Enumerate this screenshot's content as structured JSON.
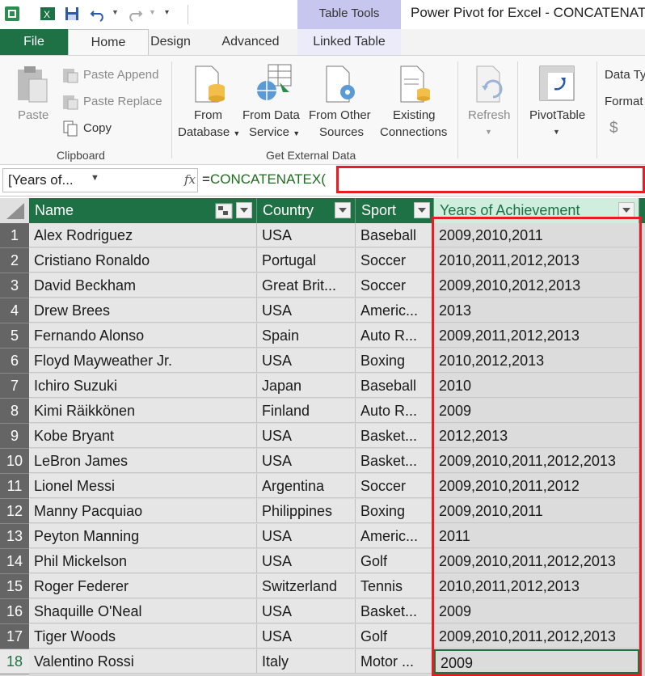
{
  "window": {
    "context_tab_group": "Table Tools",
    "title": "Power Pivot for Excel - CONCATENAT"
  },
  "tabs": {
    "file": "File",
    "home": "Home",
    "design": "Design",
    "advanced": "Advanced",
    "linked_table": "Linked Table"
  },
  "ribbon": {
    "clipboard": {
      "paste": "Paste",
      "paste_append": "Paste Append",
      "paste_replace": "Paste Replace",
      "copy": "Copy",
      "group_label": "Clipboard"
    },
    "external": {
      "from_database_1": "From",
      "from_database_2": "Database",
      "from_data_service_1": "From Data",
      "from_data_service_2": "Service",
      "from_other_sources_1": "From Other",
      "from_other_sources_2": "Sources",
      "existing_connections_1": "Existing",
      "existing_connections_2": "Connections",
      "group_label": "Get External Data"
    },
    "refresh": "Refresh",
    "pivottable": "PivotTable",
    "data_type": "Data Ty",
    "format": "Format",
    "currency": "$"
  },
  "formula_bar": {
    "name_box": "[Years of...",
    "fx": "fx",
    "eq": "=",
    "formula": "CONCATENATEX("
  },
  "table": {
    "columns": [
      "Name",
      "Country",
      "Sport",
      "Years of Achievement"
    ],
    "rows": [
      {
        "n": "1",
        "name": "Alex Rodriguez",
        "country": "USA",
        "sport": "Baseball",
        "years": "2009,2010,2011"
      },
      {
        "n": "2",
        "name": "Cristiano Ronaldo",
        "country": "Portugal",
        "sport": "Soccer",
        "years": "2010,2011,2012,2013"
      },
      {
        "n": "3",
        "name": "David Beckham",
        "country": "Great Brit...",
        "sport": "Soccer",
        "years": "2009,2010,2012,2013"
      },
      {
        "n": "4",
        "name": "Drew Brees",
        "country": "USA",
        "sport": "Americ...",
        "years": "2013"
      },
      {
        "n": "5",
        "name": "Fernando Alonso",
        "country": "Spain",
        "sport": "Auto R...",
        "years": "2009,2011,2012,2013"
      },
      {
        "n": "6",
        "name": "Floyd Mayweather Jr.",
        "country": "USA",
        "sport": "Boxing",
        "years": "2010,2012,2013"
      },
      {
        "n": "7",
        "name": "Ichiro Suzuki",
        "country": "Japan",
        "sport": "Baseball",
        "years": "2010"
      },
      {
        "n": "8",
        "name": "Kimi Räikkönen",
        "country": "Finland",
        "sport": "Auto R...",
        "years": "2009"
      },
      {
        "n": "9",
        "name": "Kobe Bryant",
        "country": "USA",
        "sport": "Basket...",
        "years": "2012,2013"
      },
      {
        "n": "10",
        "name": "LeBron James",
        "country": "USA",
        "sport": "Basket...",
        "years": "2009,2010,2011,2012,2013"
      },
      {
        "n": "11",
        "name": "Lionel Messi",
        "country": "Argentina",
        "sport": "Soccer",
        "years": "2009,2010,2011,2012"
      },
      {
        "n": "12",
        "name": "Manny Pacquiao",
        "country": "Philippines",
        "sport": "Boxing",
        "years": "2009,2010,2011"
      },
      {
        "n": "13",
        "name": "Peyton Manning",
        "country": "USA",
        "sport": "Americ...",
        "years": "2011"
      },
      {
        "n": "14",
        "name": "Phil Mickelson",
        "country": "USA",
        "sport": "Golf",
        "years": "2009,2010,2011,2012,2013"
      },
      {
        "n": "15",
        "name": "Roger Federer",
        "country": "Switzerland",
        "sport": "Tennis",
        "years": "2010,2011,2012,2013"
      },
      {
        "n": "16",
        "name": "Shaquille O'Neal",
        "country": "USA",
        "sport": "Basket...",
        "years": "2009"
      },
      {
        "n": "17",
        "name": "Tiger Woods",
        "country": "USA",
        "sport": "Golf",
        "years": "2009,2010,2011,2012,2013"
      },
      {
        "n": "18",
        "name": "Valentino Rossi",
        "country": "Italy",
        "sport": "Motor ...",
        "years": "2009"
      }
    ]
  },
  "colors": {
    "header_green": "#1e7145",
    "highlight_red": "#e81c24",
    "selected_header": "#cfeedd"
  }
}
